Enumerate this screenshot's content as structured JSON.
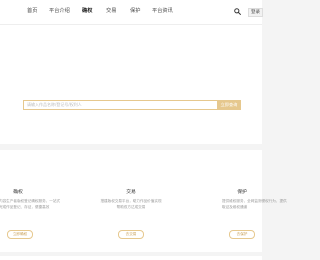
{
  "nav": {
    "items": [
      "首页",
      "平台介绍",
      "确权",
      "交易",
      "保护",
      "平台资讯"
    ],
    "active_index": 2,
    "login_label": "登录"
  },
  "search": {
    "placeholder": "请输入作品名称/登记号/权利人",
    "button_label": "立即查询"
  },
  "features": [
    {
      "title": "确权",
      "description": "内容生产者版权登记确权服务，一站式\n完成作品登记、存证，便捷高效",
      "button": "立即确权"
    },
    {
      "title": "交易",
      "description": "搭建版权交易平台，助力作品价值实现\n帮助双方达成交易",
      "button": "去交易"
    },
    {
      "title": "保护",
      "description": "提供维权服务，全网监测侵权行为，提供\n取证及维权通道",
      "button": "去保护"
    }
  ],
  "colors": {
    "accent": "#e6c88e",
    "background": "#f4f4f4"
  },
  "icons": {
    "search": "search-icon"
  }
}
